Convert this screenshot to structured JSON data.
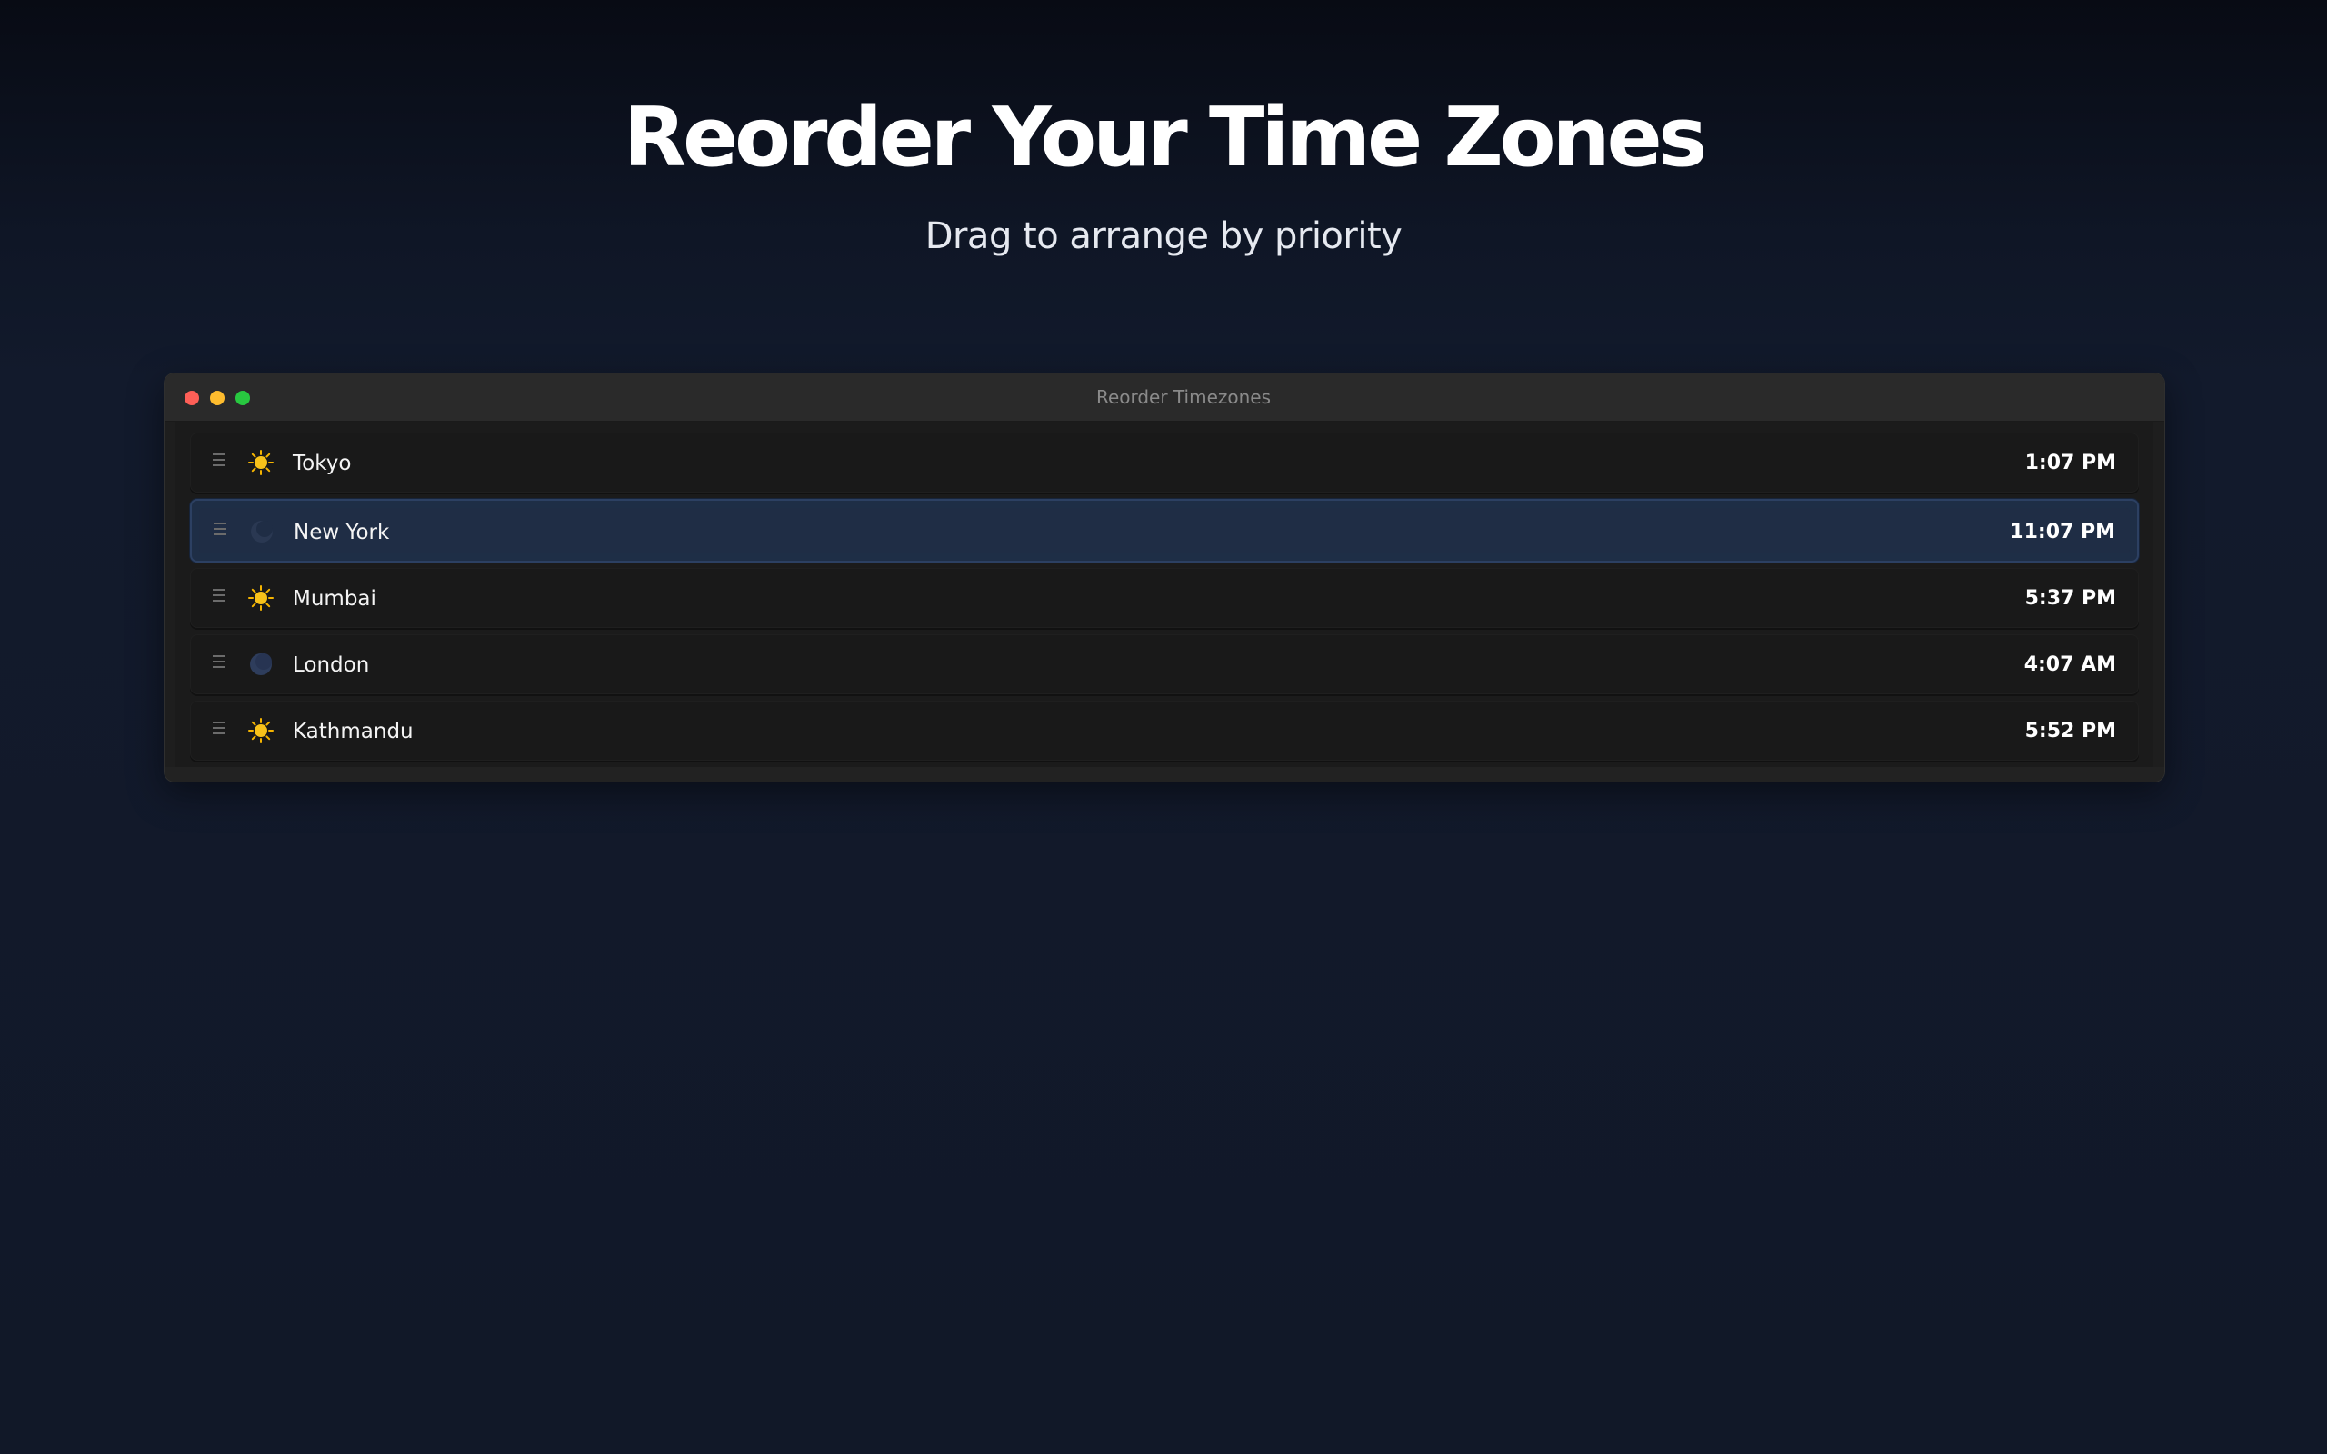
{
  "hero": {
    "title": "Reorder Your Time Zones",
    "subtitle": "Drag to arrange by priority"
  },
  "window": {
    "title": "Reorder Timezones"
  },
  "timezones": [
    {
      "city": "Tokyo",
      "time": "1:07 PM",
      "icon": "sun-icon",
      "selected": false
    },
    {
      "city": "New York",
      "time": "11:07 PM",
      "icon": "moon-icon",
      "selected": true
    },
    {
      "city": "Mumbai",
      "time": "5:37 PM",
      "icon": "sun-icon",
      "selected": false
    },
    {
      "city": "London",
      "time": "4:07 AM",
      "icon": "moon-icon",
      "selected": false
    },
    {
      "city": "Kathmandu",
      "time": "5:52 PM",
      "icon": "sun-icon",
      "selected": false
    }
  ],
  "colors": {
    "selected_row": "#1e2e46",
    "close": "#fe5f57",
    "minimize": "#febc2e",
    "zoom": "#28c840",
    "sun": "#f5b400"
  }
}
